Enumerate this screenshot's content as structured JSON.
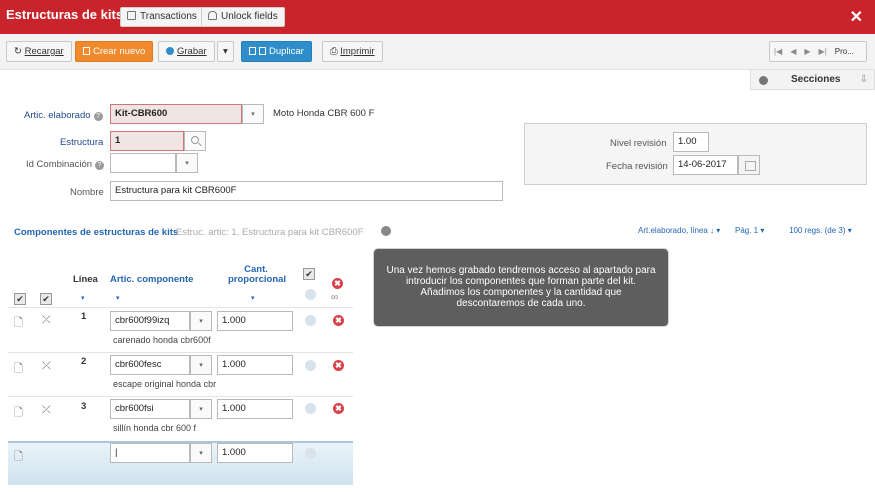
{
  "titlebar": {
    "title": "Estructuras de kits",
    "transactions_label": "Transactions",
    "unlock_label": "Unlock fields",
    "close_glyph": "✕"
  },
  "toolbar": {
    "recargar": "Recargar",
    "crear_nuevo": "Crear nuevo",
    "grabar": "Grabar",
    "duplicar": "Duplicar",
    "imprimir": "Imprimir",
    "dropdown_glyph": "▾",
    "nav": {
      "first": "|◀",
      "prev": "◀",
      "next": "▶",
      "last": "▶|",
      "pro": "Pro..."
    }
  },
  "secciones": {
    "label": "Secciones",
    "arrow": "⇩"
  },
  "form": {
    "artic_elaborado_label": "Artic. elaborado",
    "artic_elaborado_value": "Kit-CBR600",
    "artic_elaborado_desc": "Moto Honda CBR 600 F",
    "estructura_label": "Estructura",
    "estructura_value": "1",
    "id_combinacion_label": "Id Combinación",
    "id_combinacion_value": "",
    "nombre_label": "Nombre",
    "nombre_value": "Estructura para kit CBR600F",
    "help_glyph": "?",
    "nivel_revision_label": "Nivel revisión",
    "nivel_revision_value": "1.00",
    "fecha_revision_label": "Fecha revisión",
    "fecha_revision_value": "14-06-2017"
  },
  "grid": {
    "title": "Componentes de estructuras de kits",
    "subtitle": "Estruc. artic: 1, Estructura para kit CBR600F",
    "sort_info": "Art.elaborado, línea ↓ ▾",
    "page": "Pág. 1 ▾",
    "regs": "100 regs. (de 3) ▾",
    "headers": {
      "linea": "Línea",
      "artic_componente": "Artic. componente",
      "cant_line1": "Cant.",
      "cant_line2": "proporcional"
    },
    "check_glyph": "✔",
    "sort_glyph": "▾",
    "del_glyph": "✖",
    "rows": [
      {
        "linea": "1",
        "articulo": "cbr600f99izq",
        "cantidad": "1.000",
        "desc": "carenado honda cbr600f"
      },
      {
        "linea": "2",
        "articulo": "cbr600fesc",
        "cantidad": "1.000",
        "desc": "escape original honda cbr"
      },
      {
        "linea": "3",
        "articulo": "cbr600fsi",
        "cantidad": "1.000",
        "desc": "sillín honda cbr 600 f"
      }
    ],
    "new_row": {
      "articulo": "|",
      "cantidad": "1.000"
    },
    "row_icons": {
      "doc": "🗋",
      "link": "⤫"
    }
  },
  "tooltip": {
    "text": "Una vez hemos grabado tendremos acceso al apartado para introducir los componentes que forman parte del kit. Añadimos los componentes y la cantidad que descontaremos de cada uno."
  }
}
